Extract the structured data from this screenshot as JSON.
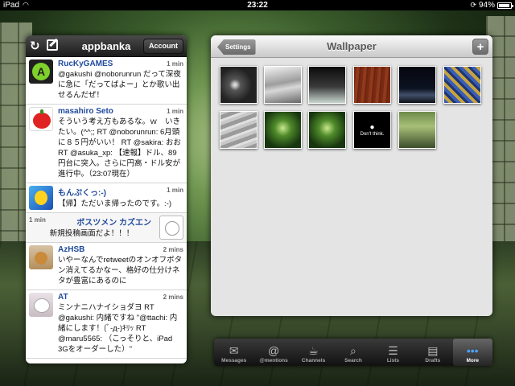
{
  "status_bar": {
    "carrier": "iPad",
    "time": "23:22",
    "battery": "94%",
    "battery_level": 0.94
  },
  "timeline": {
    "title": "appbanka",
    "account_label": "Account",
    "tweets": [
      {
        "name": "RucKyGAMES",
        "ago": "1 min",
        "body": "@gakushi @noborunrun だって深夜に急に「だってばよー」とか歌い出せるんだぜ！"
      },
      {
        "name": "masahiro Seto",
        "ago": "1 min",
        "body": "そういう考え方もあるな。ｗ　いきたい。(^^;; RT @noborunrun: 6月頭に８５円がいい！ RT @sakira: おお RT @asuka_xp: 【速報】ドル、89円台に突入。さらに円高・ドル安が進行中。（23:07現在）"
      },
      {
        "name": "もんぷくっ:-)",
        "ago": "1 min",
        "body": "【帰】ただいま帰ったのです。:-)"
      },
      {
        "name": "ボスツメン カズエン",
        "ago": "1 min",
        "body": "新規投稿画面だよ！！！"
      },
      {
        "name": "AzHSB",
        "ago": "2 mins",
        "body": "いやーなんでretweetのオンオフボタン消えてるかなー、格好の仕分けネタが豊富にあるのに"
      },
      {
        "name": "AT",
        "ago": "2 mins",
        "body": "ミンナニハナイショダヨ RT @gakushi: 内緒ですね \"@ttachi: 内緒にします！(ﾞ-д-)ｷﾘｯ RT @maru5565: （こっそりと、iPad 3Gをオーダーした）\""
      }
    ]
  },
  "wallpaper": {
    "back_label": "Settings",
    "title": "Wallpaper",
    "add_label": "+",
    "dont_think": "Don't think.",
    "thumbnails": [
      {
        "name": "thumb-nebula"
      },
      {
        "name": "thumb-silver-wave"
      },
      {
        "name": "thumb-dark-gradient"
      },
      {
        "name": "thumb-wood"
      },
      {
        "name": "thumb-night-horizon"
      },
      {
        "name": "thumb-mosaic"
      },
      {
        "name": "thumb-sand"
      },
      {
        "name": "thumb-forest-1"
      },
      {
        "name": "thumb-forest-2"
      },
      {
        "name": "thumb-dont-think"
      },
      {
        "name": "thumb-shoji-room"
      }
    ]
  },
  "tab_bar": {
    "tabs": [
      {
        "label": "Messages",
        "icon": "envelope-icon",
        "active": false
      },
      {
        "label": "@mentions",
        "icon": "at-icon",
        "active": false
      },
      {
        "label": "Channels",
        "icon": "coffee-icon",
        "active": false
      },
      {
        "label": "Search",
        "icon": "search-icon",
        "active": false
      },
      {
        "label": "Lists",
        "icon": "list-icon",
        "active": false
      },
      {
        "label": "Drafts",
        "icon": "drafts-icon",
        "active": false
      },
      {
        "label": "More",
        "icon": "more-icon",
        "active": true
      }
    ]
  }
}
